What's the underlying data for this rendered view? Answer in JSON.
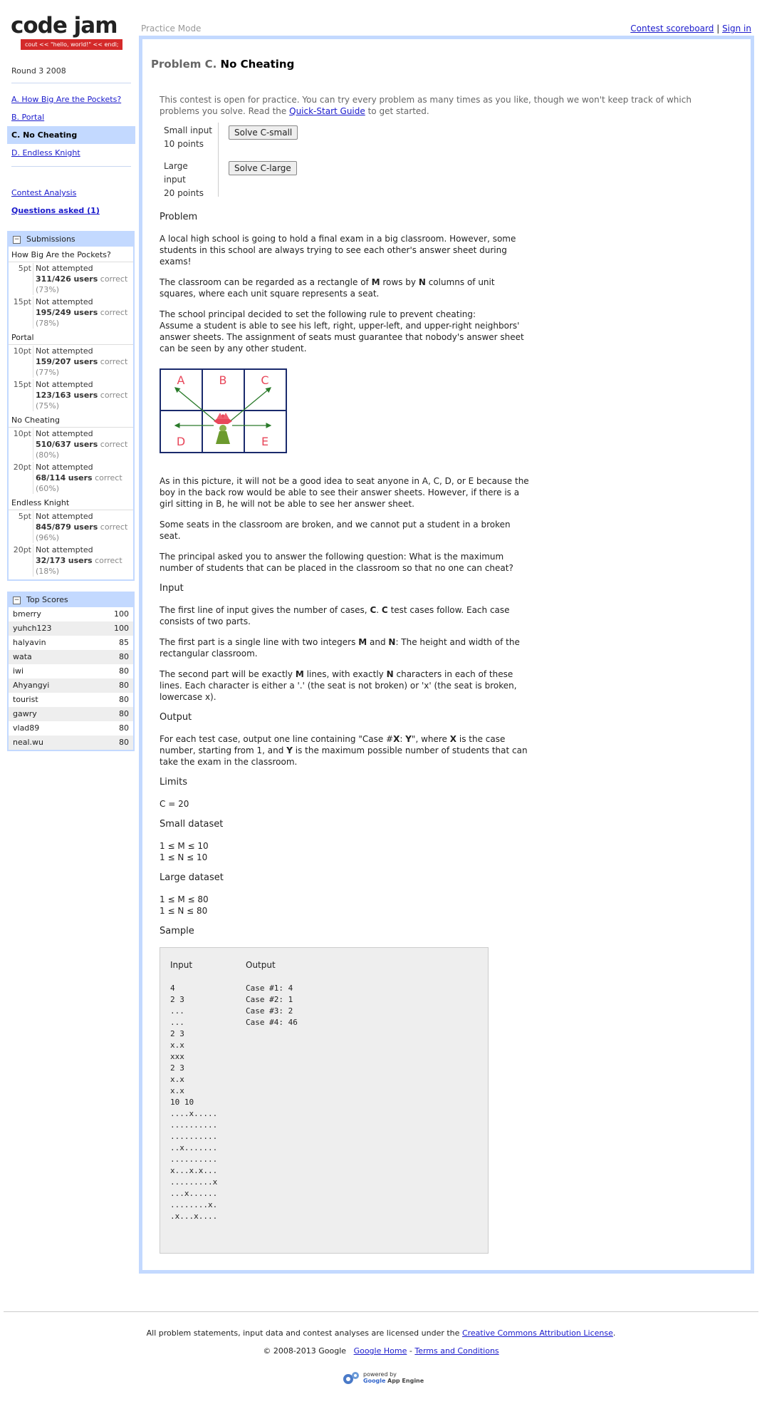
{
  "logo": {
    "title": "code jam",
    "tagline": "cout << \"hello, world!\" << endl;"
  },
  "sidebar": {
    "round": "Round 3 2008",
    "problems": [
      {
        "label": "A. How Big Are the Pockets?"
      },
      {
        "label": "B. Portal"
      },
      {
        "label": "C. No Cheating"
      },
      {
        "label": "D. Endless Knight"
      }
    ],
    "links": [
      {
        "label": "Contest Analysis"
      },
      {
        "label": "Questions asked (1)"
      }
    ],
    "submissions": {
      "title": "Submissions",
      "groups": [
        {
          "name": "How Big Are the Pockets?",
          "rows": [
            {
              "pts": "5pt",
              "status": "Not attempted",
              "users": "311/426",
              "suffix": "users",
              "correct": "correct",
              "pct": "(73%)"
            },
            {
              "pts": "15pt",
              "status": "Not attempted",
              "users": "195/249",
              "suffix": "users",
              "correct": "correct",
              "pct": "(78%)"
            }
          ]
        },
        {
          "name": "Portal",
          "rows": [
            {
              "pts": "10pt",
              "status": "Not attempted",
              "users": "159/207",
              "suffix": "users",
              "correct": "correct",
              "pct": "(77%)"
            },
            {
              "pts": "15pt",
              "status": "Not attempted",
              "users": "123/163",
              "suffix": "users",
              "correct": "correct",
              "pct": "(75%)"
            }
          ]
        },
        {
          "name": "No Cheating",
          "rows": [
            {
              "pts": "10pt",
              "status": "Not attempted",
              "users": "510/637",
              "suffix": "users",
              "correct": "correct",
              "pct": "(80%)"
            },
            {
              "pts": "20pt",
              "status": "Not attempted",
              "users": "68/114",
              "suffix": "users",
              "correct": "correct",
              "pct": "(60%)"
            }
          ]
        },
        {
          "name": "Endless Knight",
          "rows": [
            {
              "pts": "5pt",
              "status": "Not attempted",
              "users": "845/879",
              "suffix": "users",
              "correct": "correct",
              "pct": "(96%)"
            },
            {
              "pts": "20pt",
              "status": "Not attempted",
              "users": "32/173",
              "suffix": "users",
              "correct": "correct",
              "pct": "(18%)"
            }
          ]
        }
      ]
    },
    "top_scores": {
      "title": "Top Scores",
      "rows": [
        {
          "name": "bmerry",
          "score": "100"
        },
        {
          "name": "yuhch123",
          "score": "100"
        },
        {
          "name": "halyavin",
          "score": "85"
        },
        {
          "name": "wata",
          "score": "80"
        },
        {
          "name": "iwi",
          "score": "80"
        },
        {
          "name": "Ahyangyi",
          "score": "80"
        },
        {
          "name": "tourist",
          "score": "80"
        },
        {
          "name": "gawry",
          "score": "80"
        },
        {
          "name": "vlad89",
          "score": "80"
        },
        {
          "name": "neal.wu",
          "score": "80"
        }
      ]
    }
  },
  "header": {
    "mode": "Practice Mode",
    "scoreboard": "Contest scoreboard",
    "separator": "|",
    "signin": "Sign in"
  },
  "problem": {
    "prefix": "Problem C.",
    "name": "No Cheating",
    "practice_note_1": "This contest is open for practice. You can try every problem as many times as you like, though we won't keep track of which problems you solve. Read the",
    "practice_link": "Quick-Start Guide",
    "practice_note_2": "to get started.",
    "inputs": [
      {
        "label": "Small input",
        "points": "10 points",
        "button": "Solve C-small"
      },
      {
        "label": "Large input",
        "points": "20 points",
        "button": "Solve C-large"
      }
    ],
    "sections": {
      "problem": "Problem",
      "input": "Input",
      "output": "Output",
      "limits": "Limits",
      "small": "Small dataset",
      "large": "Large dataset",
      "sample": "Sample"
    },
    "p1": "A local high school is going to hold a final exam in a big classroom. However, some students in this school are always trying to see each other's answer sheet during exams!",
    "p2a": "The classroom can be regarded as a rectangle of",
    "p2M": "M",
    "p2b": "rows by",
    "p2N": "N",
    "p2c": "columns of unit squares, where each unit square represents a seat.",
    "p3a": "The school principal decided to set the following rule to prevent cheating:",
    "p3b": "Assume a student is able to see his left, right, upper-left, and upper-right neighbors' answer sheets. The assignment of seats must guarantee that nobody's answer sheet can be seen by any other student.",
    "grid_labels": [
      "A",
      "B",
      "C",
      "D",
      "E"
    ],
    "p4": "As in this picture, it will not be a good idea to seat anyone in A, C, D, or E because the boy in the back row would be able to see their answer sheets. However, if there is a girl sitting in B, he will not be able to see her answer sheet.",
    "p5": "Some seats in the classroom are broken, and we cannot put a student in a broken seat.",
    "p6": "The principal asked you to answer the following question: What is the maximum number of students that can be placed in the classroom so that no one can cheat?",
    "in1a": "The first line of input gives the number of cases,",
    "in1C": "C",
    "in1b": ".",
    "in1C2": "C",
    "in1c": "test cases follow. Each case consists of two parts.",
    "in2a": "The first part is a single line with two integers",
    "in2M": "M",
    "in2b": "and",
    "in2N": "N",
    "in2c": ": The height and width of the rectangular classroom.",
    "in3a": "The second part will be exactly",
    "in3M": "M",
    "in3b": "lines, with exactly",
    "in3N": "N",
    "in3c": "characters in each of these lines. Each character is either a '.' (the seat is not broken) or 'x' (the seat is broken, lowercase x).",
    "out1a": "For each test case, output one line containing \"Case #",
    "out1X": "X",
    "out1b": ":",
    "out1Y": "Y",
    "out1c": "\", where",
    "out1X2": "X",
    "out1d": "is the case number, starting from 1, and",
    "out1Y2": "Y",
    "out1e": "is the maximum possible number of students that can take the exam in the classroom.",
    "limits_c": "C = 20",
    "small_m": "1 ≤ M ≤ 10",
    "small_n": "1 ≤ N ≤ 10",
    "large_m": "1 ≤ M ≤ 80",
    "large_n": "1 ≤ N ≤ 80",
    "sample": {
      "input_head": "Input",
      "output_head": "Output",
      "input": "4\n2 3\n...\n...\n2 3\nx.x\nxxx\n2 3\nx.x\nx.x\n10 10\n....x.....\n..........\n..........\n..x.......\n..........\nx...x.x...\n.........x\n...x......\n........x.\n.x...x....",
      "output": "Case #1: 4\nCase #2: 1\nCase #3: 2\nCase #4: 46"
    }
  },
  "footer": {
    "license_text": "All problem statements, input data and contest analyses are licensed under the",
    "license_link": "Creative Commons Attribution License",
    "license_end": ".",
    "copyright": "© 2008-2013 Google",
    "home_link": "Google Home",
    "sep": "-",
    "terms_link": "Terms and Conditions",
    "powered": "powered by",
    "engine_brand": "Google",
    "engine_name": "App Engine"
  },
  "colors": {
    "accent": "#c3d9ff",
    "link": "#1a1acc",
    "logo_tag": "#d42a2a",
    "grid_border": "#1a2a6c",
    "grid_label": "#e8475a",
    "arrow": "#2a7a2a"
  }
}
